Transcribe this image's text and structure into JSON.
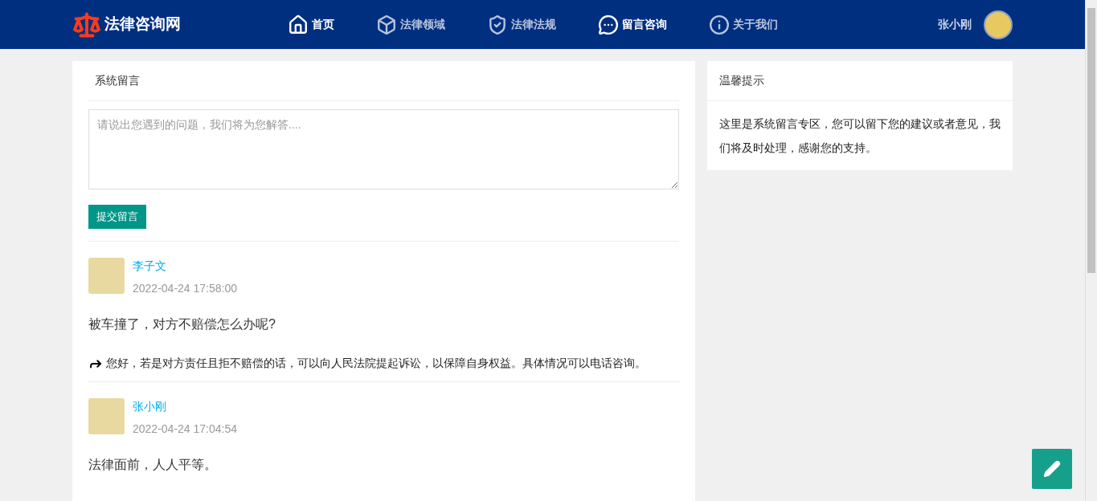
{
  "header": {
    "logo": "法律咨询网",
    "nav": [
      {
        "label": "首页",
        "kind": "home",
        "selected": true
      },
      {
        "label": "法律领域",
        "kind": "box",
        "selected": false
      },
      {
        "label": "法律法规",
        "kind": "shield",
        "selected": false
      },
      {
        "label": "留言咨询",
        "kind": "chat",
        "selected": true
      },
      {
        "label": "关于我们",
        "kind": "info",
        "selected": false
      }
    ],
    "user": "张小刚"
  },
  "message_panel": {
    "title": "系统留言",
    "placeholder": "请说出您遇到的问题，我们将为您解答....",
    "submit": "提交留言",
    "messages": [
      {
        "author": "李子文",
        "time": "2022-04-24 17:58:00",
        "text": "被车撞了，对方不赔偿怎么办呢?",
        "reply": "您好，若是对方责任且拒不赔偿的话，可以向人民法院提起诉讼，以保障自身权益。具体情况可以电话咨询。"
      },
      {
        "author": "张小刚",
        "time": "2022-04-24 17:04:54",
        "text": "法律面前，人人平等。"
      }
    ]
  },
  "tips": {
    "title": "温馨提示",
    "text": "这里是系统留言专区，您可以留下您的建议或者意见，我们将及时处理，感谢您的支持。"
  }
}
